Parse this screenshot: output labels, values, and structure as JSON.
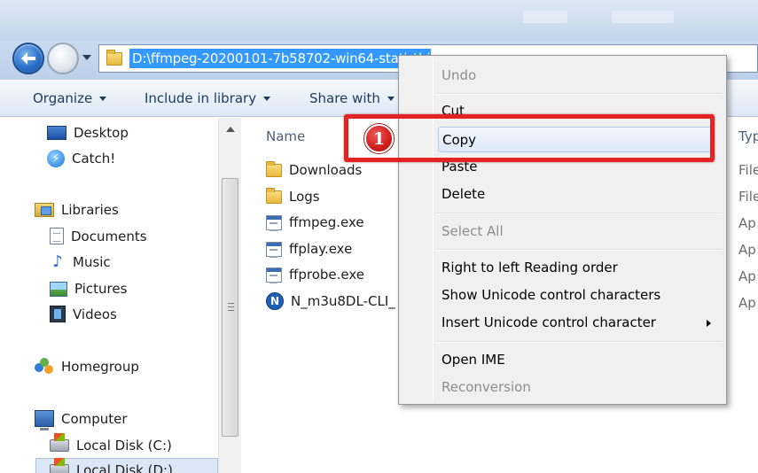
{
  "address_bar": {
    "path": "D:\\ffmpeg-20200101-7b58702-win64-static\\bin"
  },
  "toolbar": {
    "organize": "Organize",
    "include_in_library": "Include in library",
    "share_with": "Share with"
  },
  "navigation": {
    "favorites": [
      {
        "label": "Desktop",
        "icon": "desktop-icon"
      },
      {
        "label": "Catch!",
        "icon": "catch-icon"
      }
    ],
    "libraries": {
      "label": "Libraries",
      "items": [
        {
          "label": "Documents",
          "icon": "documents-icon"
        },
        {
          "label": "Music",
          "icon": "music-icon"
        },
        {
          "label": "Pictures",
          "icon": "pictures-icon"
        },
        {
          "label": "Videos",
          "icon": "videos-icon"
        }
      ]
    },
    "homegroup": "Homegroup",
    "computer": {
      "label": "Computer",
      "items": [
        {
          "label": "Local Disk (C:)"
        },
        {
          "label": "Local Disk (D:)"
        }
      ]
    }
  },
  "file_list": {
    "columns": {
      "name": "Name",
      "type": "Typ"
    },
    "rows": [
      {
        "name": "Downloads",
        "icon": "folder-icon",
        "type": "File"
      },
      {
        "name": "Logs",
        "icon": "folder-icon",
        "type": "File"
      },
      {
        "name": "ffmpeg.exe",
        "icon": "exe-icon",
        "type": "Ap"
      },
      {
        "name": "ffplay.exe",
        "icon": "exe-icon",
        "type": "Ap"
      },
      {
        "name": "ffprobe.exe",
        "icon": "exe-icon",
        "type": "Ap"
      },
      {
        "name": "N_m3u8DL-CLI_",
        "icon": "n-app-icon",
        "type": "Ap"
      }
    ]
  },
  "context_menu": {
    "items": [
      {
        "label": "Undo",
        "disabled": true
      },
      {
        "label": "Cut",
        "disabled": false
      },
      {
        "label": "Copy",
        "disabled": false,
        "highlighted": true
      },
      {
        "label": "Paste",
        "disabled": false
      },
      {
        "label": "Delete",
        "disabled": false
      },
      {
        "label": "Select All",
        "disabled": true
      },
      {
        "label": "Right to left Reading order",
        "disabled": false
      },
      {
        "label": "Show Unicode control characters",
        "disabled": false
      },
      {
        "label": "Insert Unicode control character",
        "disabled": false,
        "submenu": true
      },
      {
        "label": "Open IME",
        "disabled": false
      },
      {
        "label": "Reconversion",
        "disabled": true
      }
    ]
  },
  "annotation": {
    "step_number": "1",
    "color": "#e12323"
  },
  "colors": {
    "selection": "#3399ff",
    "menu_hover": "#dde9f8",
    "disabled_text": "#8d8d8d"
  }
}
